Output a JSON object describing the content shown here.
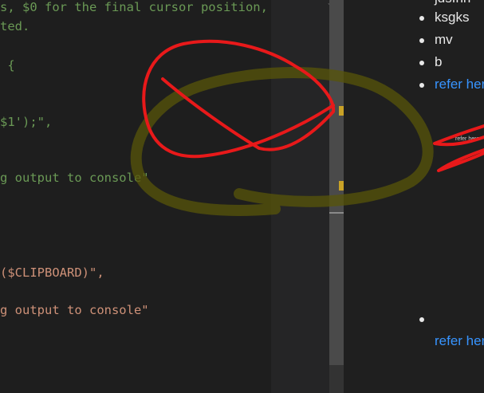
{
  "editor": {
    "lines": [
      {
        "text": "s, $0 for the final cursor position,",
        "color": "#6a9955"
      },
      {
        "text": "ted.",
        "color": "#6a9955"
      },
      {
        "text": " {",
        "color": "#6a9955"
      },
      {
        "text": "$1');\",",
        "color": "#6a9955"
      },
      {
        "text": "g output to console\"",
        "color": "#6a9955"
      },
      {
        "text": "($CLIPBOARD)\",",
        "color": "#ce9178"
      },
      {
        "text": "g output to console\"",
        "color": "#ce9178"
      }
    ],
    "minimap_char": "`"
  },
  "preview": {
    "partial_top_item": "jdsfhh",
    "items": [
      "ksgks",
      "mv",
      "b"
    ],
    "link_label_1": "refer her",
    "link_label_2": "refer her",
    "tiny_link_text": "refer here"
  },
  "colors": {
    "annotation_red": "#e8191a",
    "annotation_olive": "#58550a",
    "link_blue": "#3794ff"
  }
}
